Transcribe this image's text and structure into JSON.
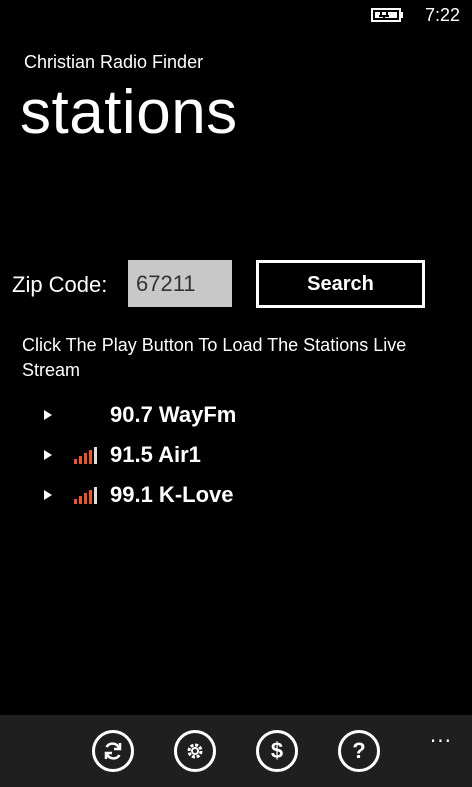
{
  "statusbar": {
    "time": "7:22"
  },
  "app": {
    "title": "Christian Radio Finder",
    "page_title": "stations"
  },
  "search": {
    "zip_label": "Zip Code:",
    "zip_value": "67211",
    "button_label": "Search"
  },
  "instructions": "Click The Play Button To Load The Stations Live Stream",
  "stations": [
    {
      "name": "90.7 WayFm",
      "signal": false
    },
    {
      "name": "91.5 Air1",
      "signal": true
    },
    {
      "name": "99.1 K-Love",
      "signal": true
    }
  ],
  "appbar": {
    "buttons": [
      "refresh-icon",
      "settings-icon",
      "dollar-icon",
      "help-icon"
    ],
    "more": "..."
  },
  "colors": {
    "signal_bars": "#e8572a",
    "appbar_bg": "#1f1f1f",
    "input_bg": "#c8c8c8"
  }
}
